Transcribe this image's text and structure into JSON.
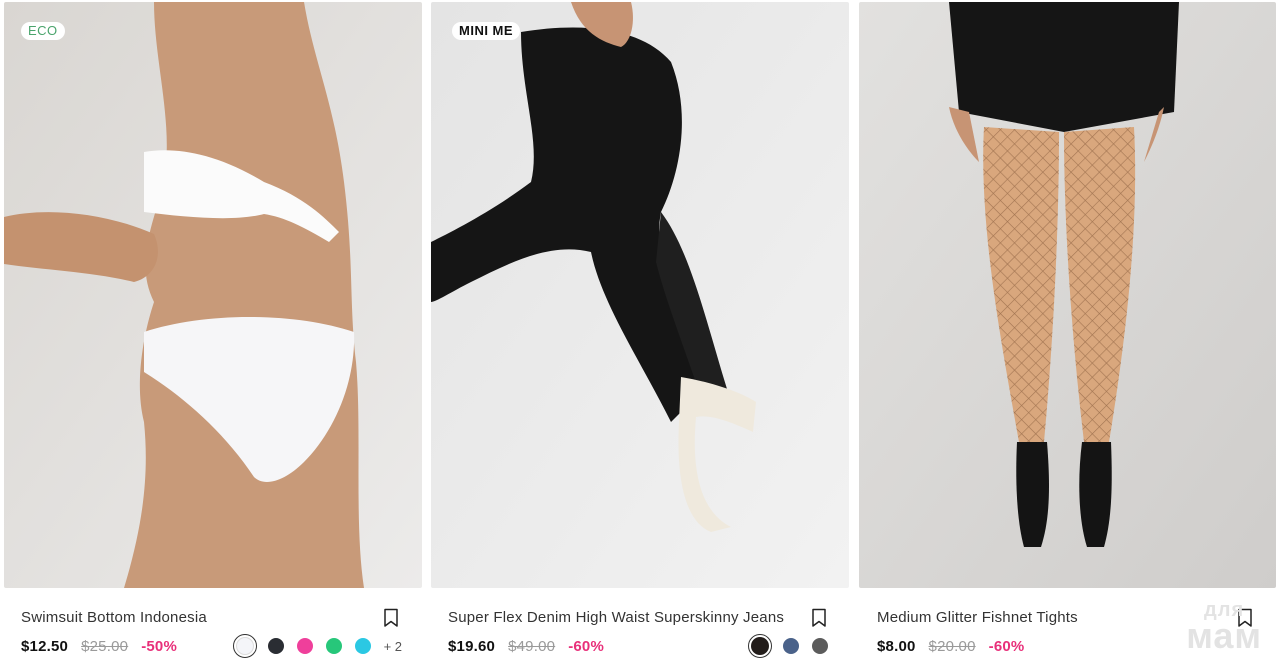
{
  "products": [
    {
      "badge": "ECO",
      "title": "Swimsuit Bottom Indonesia",
      "price": "$12.50",
      "old_price": "$25.00",
      "discount": "-50%",
      "colors": [
        "#f4f5f9",
        "#2a2d33",
        "#ef3f9b",
        "#27c77a",
        "#2bc8e3"
      ],
      "selected_color_index": 0,
      "more_colors": "+ 2"
    },
    {
      "badge": "MINI ME",
      "title": "Super Flex Denim High Waist Superskinny Jeans",
      "price": "$19.60",
      "old_price": "$49.00",
      "discount": "-60%",
      "colors": [
        "#231d1b",
        "#4a628a",
        "#5c5c5c"
      ],
      "selected_color_index": 0
    },
    {
      "title": "Medium Glitter Fishnet Tights",
      "price": "$8.00",
      "old_price": "$20.00",
      "discount": "-60%"
    }
  ],
  "watermark": {
    "line1": "для",
    "line2": "мам"
  },
  "icons": {
    "bookmark": "bookmark-icon"
  }
}
